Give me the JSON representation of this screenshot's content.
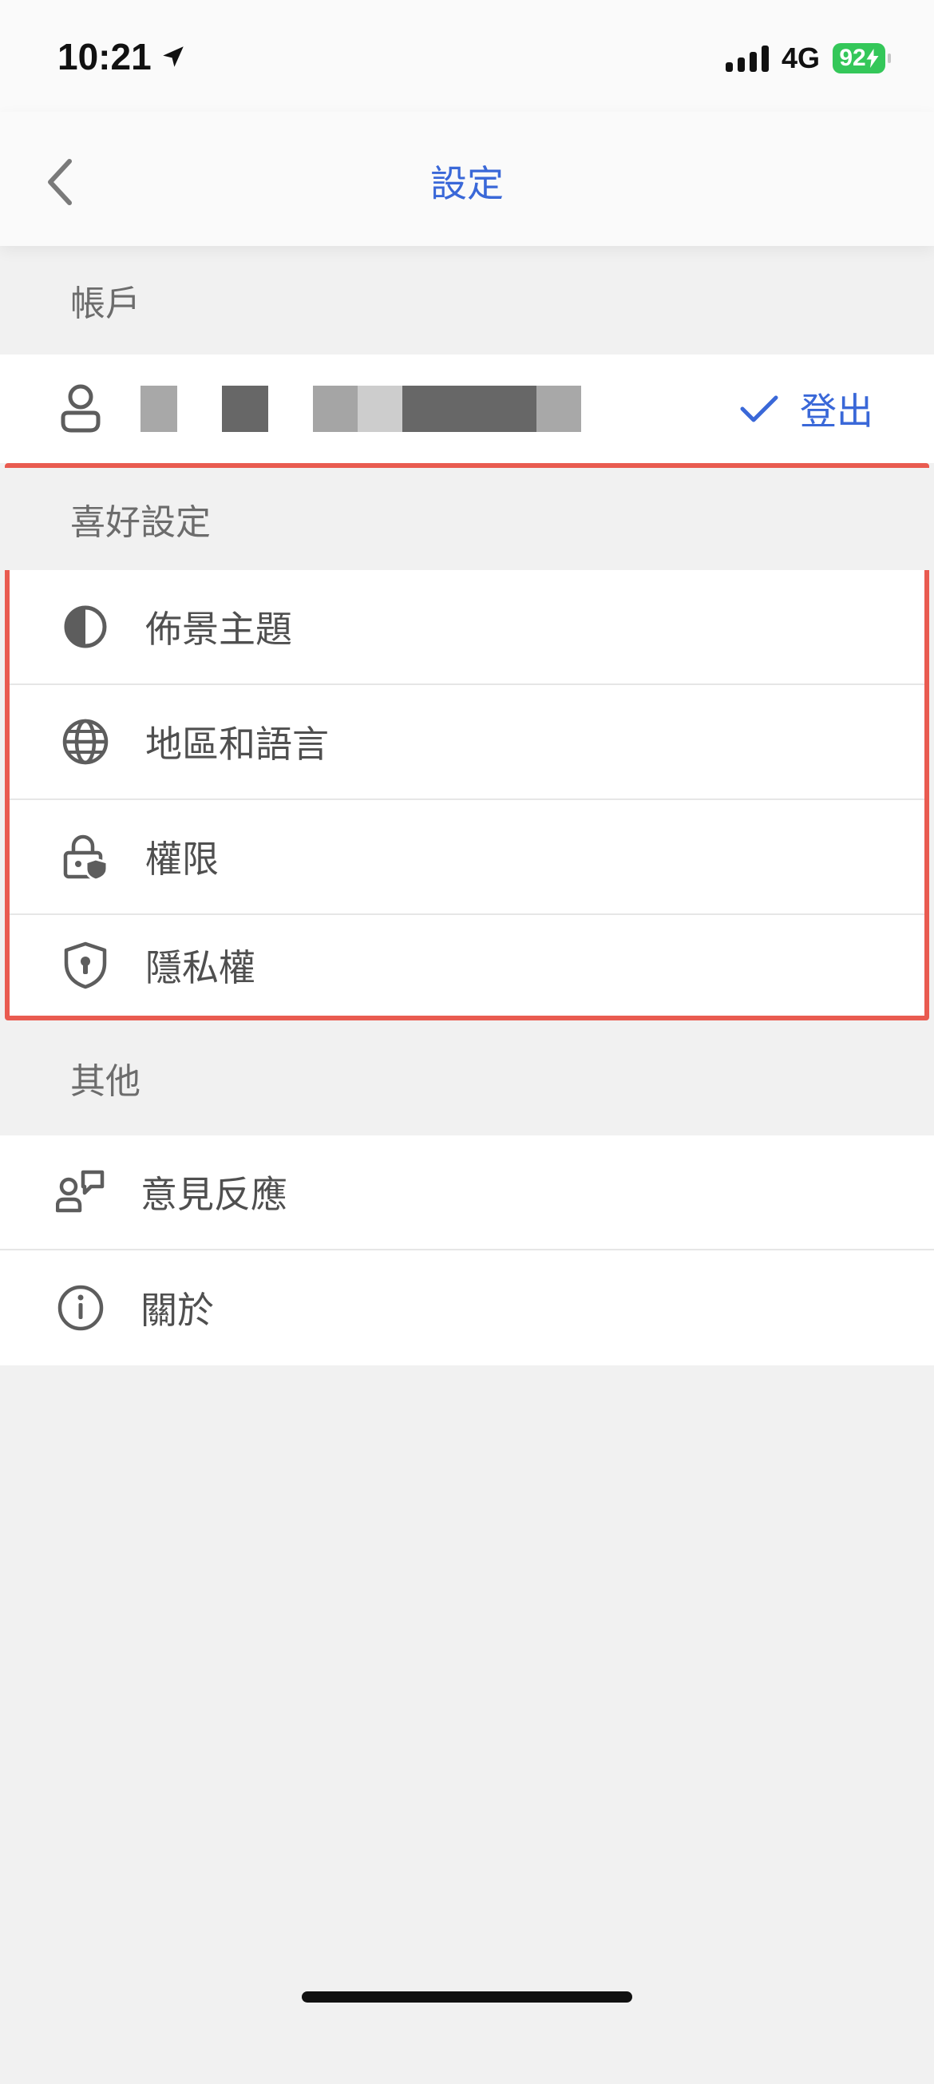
{
  "status_bar": {
    "time": "10:21",
    "network": "4G",
    "battery": "92"
  },
  "nav": {
    "title": "設定",
    "back_icon": "chevron-left-icon"
  },
  "sections": {
    "account": {
      "header": "帳戶",
      "logout_label": "登出"
    },
    "preferences": {
      "header": "喜好設定",
      "items": [
        {
          "label": "佈景主題",
          "icon": "contrast-icon"
        },
        {
          "label": "地區和語言",
          "icon": "globe-icon"
        },
        {
          "label": "權限",
          "icon": "lock-shield-icon"
        },
        {
          "label": "隱私權",
          "icon": "shield-lock-icon"
        }
      ]
    },
    "other": {
      "header": "其他",
      "items": [
        {
          "label": "意見反應",
          "icon": "feedback-icon"
        },
        {
          "label": "關於",
          "icon": "info-icon"
        }
      ]
    }
  },
  "colors": {
    "accent": "#3a68d8",
    "highlight": "#e95b50",
    "battery": "#34c759"
  }
}
